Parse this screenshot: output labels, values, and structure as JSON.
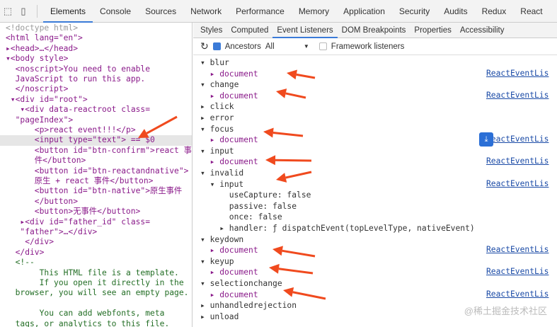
{
  "toolbar": {
    "tabs": [
      "Elements",
      "Console",
      "Sources",
      "Network",
      "Performance",
      "Memory",
      "Application",
      "Security",
      "Audits",
      "Redux",
      "React"
    ],
    "active": "Elements"
  },
  "elements": {
    "lines": [
      "<!doctype html>",
      "<html lang=\"en\">",
      "▸<head>…</head>",
      "▾<body style>",
      "  <noscript>You need to enable",
      "  JavaScript to run this app.",
      "  </noscript>",
      " ▾<div id=\"root\">",
      "   ▾<div data-reactroot class=",
      "  \"pageIndex\">",
      "      <p>react event!!!</p>",
      "      <input type=\"text\"> == $0",
      "      <button id=\"btn-confirm\">react 事",
      "      件</button>",
      "      <button id=\"btn-reactandnative\">",
      "      原生 + react 事件</button>",
      "      <button id=\"btn-native\">原生事件",
      "      </button>",
      "      <button>无事件</button>",
      "   ▸<div id=\"father_id\" class=",
      "   \"father\">…</div>",
      "    </div>",
      "  </div>",
      "  <!--",
      "       This HTML file is a template.",
      "       If you open it directly in the",
      "  browser, you will see an empty page.",
      "",
      "       You can add webfonts, meta",
      "  tags, or analytics to this file."
    ]
  },
  "sidebar": {
    "tabs": [
      "Styles",
      "Computed",
      "Event Listeners",
      "DOM Breakpoints",
      "Properties",
      "Accessibility"
    ],
    "active": "Event Listeners",
    "ancestors_label": "Ancestors",
    "filter_value": "All",
    "framework_label": "Framework listeners",
    "events": [
      {
        "text": "▾ blur",
        "kind": "ev"
      },
      {
        "text": "  ▸ document",
        "kind": "doc",
        "link": "ReactEventLis"
      },
      {
        "text": "▾ change",
        "kind": "ev"
      },
      {
        "text": "  ▸ document",
        "kind": "doc",
        "link": "ReactEventLis"
      },
      {
        "text": "▸ click",
        "kind": "ev"
      },
      {
        "text": "▸ error",
        "kind": "ev"
      },
      {
        "text": "▾ focus",
        "kind": "ev"
      },
      {
        "text": "  ▸ document",
        "kind": "doc",
        "link": "ReactEventLis"
      },
      {
        "text": "▾ input",
        "kind": "ev"
      },
      {
        "text": "  ▸ document",
        "kind": "doc",
        "link": "ReactEventLis"
      },
      {
        "text": "▾ invalid",
        "kind": "ev"
      },
      {
        "text": "  ▾ input",
        "kind": "ev",
        "link": "ReactEventLis"
      },
      {
        "text": "      useCapture: false",
        "kind": "prop"
      },
      {
        "text": "      passive: false",
        "kind": "prop"
      },
      {
        "text": "      once: false",
        "kind": "prop"
      },
      {
        "text": "    ▸ handler: ƒ dispatchEvent(topLevelType, nativeEvent)",
        "kind": "prop"
      },
      {
        "text": "▾ keydown",
        "kind": "ev"
      },
      {
        "text": "  ▸ document",
        "kind": "doc",
        "link": "ReactEventLis"
      },
      {
        "text": "▾ keyup",
        "kind": "ev"
      },
      {
        "text": "  ▸ document",
        "kind": "doc",
        "link": "ReactEventLis"
      },
      {
        "text": "▾ selectionchange",
        "kind": "ev"
      },
      {
        "text": "  ▸ document",
        "kind": "doc",
        "link": "ReactEventLis"
      },
      {
        "text": "▸ unhandledrejection",
        "kind": "ev"
      },
      {
        "text": "▸ unload",
        "kind": "ev"
      }
    ]
  },
  "watermark": "@稀土掘金技术社区",
  "colors": {
    "arrow": "#f04a1e",
    "accent": "#3b7bd8"
  }
}
